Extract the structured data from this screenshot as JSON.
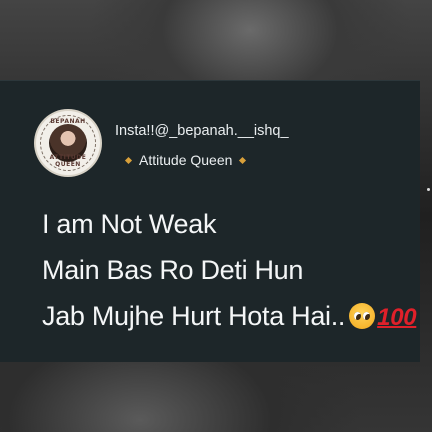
{
  "profile": {
    "badge_top_text": "BEPANAH",
    "badge_bottom_text": "ATTITUDE QUEEN",
    "handle": "Insta!!@_bepanah.__ishq_",
    "subtitle": "Attitude Queen"
  },
  "quote": {
    "line1": "I am Not Weak",
    "line2": "Main Bas Ro Deti Hun",
    "line3": "Jab Mujhe Hurt Hota Hai.."
  },
  "icons": {
    "emoji_1": "pleading-face-icon",
    "emoji_2": "hundred-points-icon"
  },
  "colors": {
    "card": "#1d2629",
    "text": "#f4f6f7",
    "accent_diamond": "#d9a03a"
  }
}
